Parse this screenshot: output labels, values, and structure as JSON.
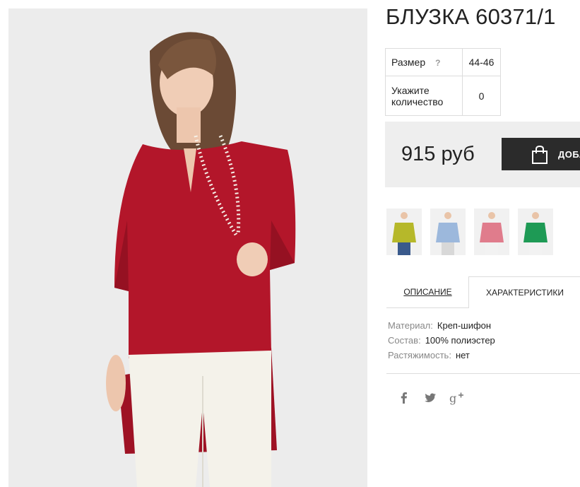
{
  "product": {
    "title": "БЛУЗКА 60371/1",
    "image_alt": "Woman in a red chiffon blouse with pearl necklace and white trousers"
  },
  "options": {
    "size_label": "Размер",
    "size_help": "?",
    "size_value": "44-46",
    "qty_label": "Укажите количество",
    "qty_value": "0"
  },
  "purchase": {
    "price": "915 руб",
    "cart_label": "ДОБАВИТЬ"
  },
  "thumbnails": [
    {
      "color_name": "olive",
      "color": "#b6b82a"
    },
    {
      "color_name": "light-blue",
      "color": "#9cb8dc"
    },
    {
      "color_name": "pink",
      "color": "#e07c8c"
    },
    {
      "color_name": "green",
      "color": "#1e9a55"
    }
  ],
  "tabs": [
    {
      "label": "ОПИСАНИЕ",
      "active": false
    },
    {
      "label": "ХАРАКТЕРИСТИКИ",
      "active": true
    }
  ],
  "specs": [
    {
      "label": "Материал:",
      "value": "Креп-шифон"
    },
    {
      "label": "Состав:",
      "value": "100% полиэстер"
    },
    {
      "label": "Растяжимость:",
      "value": "нет"
    }
  ],
  "social": [
    {
      "icon": "facebook-icon",
      "glyph": "f"
    },
    {
      "icon": "twitter-icon",
      "glyph": "t"
    },
    {
      "icon": "google-plus-icon",
      "glyph": "g+"
    }
  ],
  "colors": {
    "blouse": "#b3162a",
    "button": "#2b2b2b",
    "price_bg": "#eeeeee"
  }
}
